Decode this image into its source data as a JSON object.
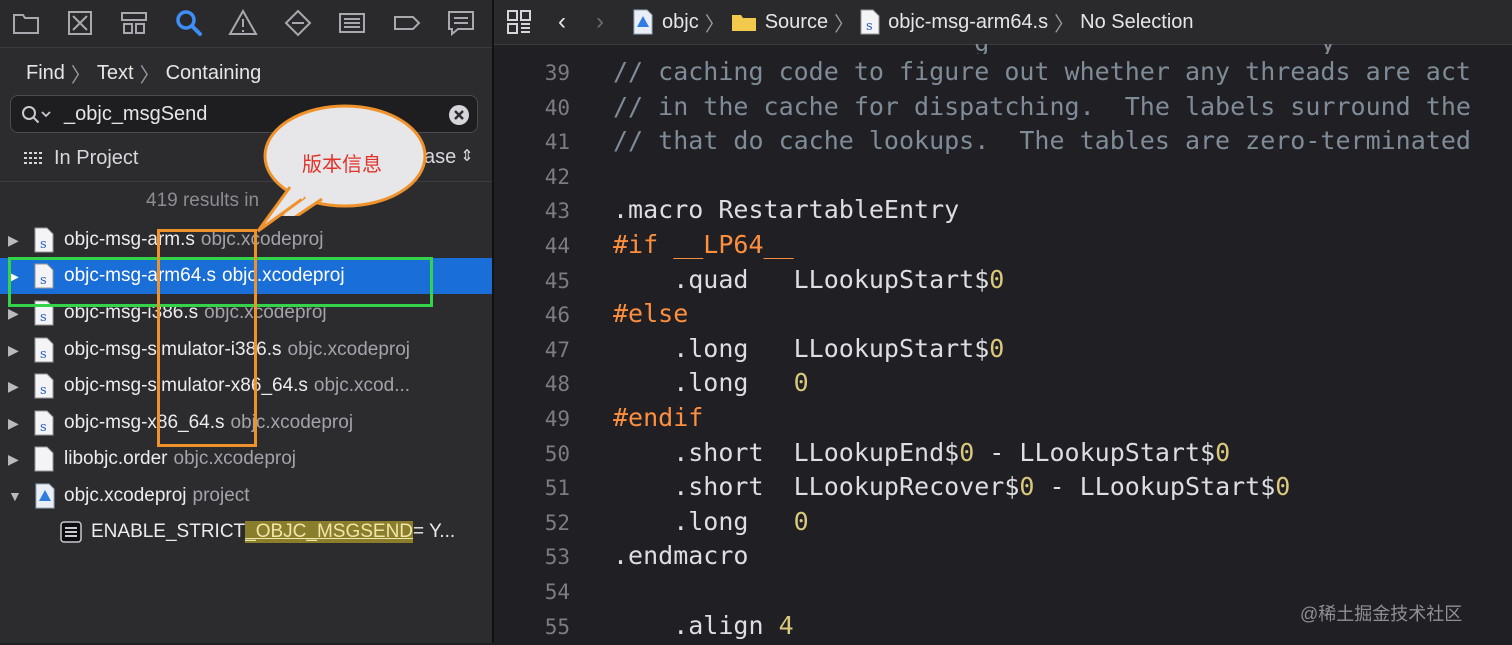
{
  "navigator": {
    "breadcrumb": [
      "Find",
      "Text",
      "Containing"
    ],
    "search": {
      "value": "_objc_msgSend"
    },
    "scope": {
      "label": "In Project",
      "option": "ase"
    },
    "results_count": "419 results in",
    "results": [
      {
        "file": "objc-msg-arm.s",
        "project": "objc.xcodeproj",
        "expanded": false,
        "selected": false
      },
      {
        "file": "objc-msg-arm64.s",
        "project": "objc.xcodeproj",
        "expanded": false,
        "selected": true
      },
      {
        "file": "objc-msg-i386.s",
        "project": "objc.xcodeproj",
        "expanded": false,
        "selected": false
      },
      {
        "file": "objc-msg-simulator-i386.s",
        "project": "objc.xcodeproj",
        "expanded": false,
        "selected": false
      },
      {
        "file": "objc-msg-simulator-x86_64.s",
        "project": "objc.xcod...",
        "expanded": false,
        "selected": false
      },
      {
        "file": "objc-msg-x86_64.s",
        "project": "objc.xcodeproj",
        "expanded": false,
        "selected": false
      },
      {
        "file": "libobjc.order",
        "project": "objc.xcodeproj",
        "expanded": false,
        "selected": false
      },
      {
        "file": "objc.xcodeproj",
        "project": "project",
        "expanded": true,
        "selected": false
      }
    ],
    "setting_match": {
      "prefix": "ENABLE_STRICT",
      "match": "_OBJC_MSGSEND",
      "suffix": " = Y..."
    }
  },
  "jumpbar": {
    "items": [
      "objc",
      "Source",
      "objc-msg-arm64.s",
      "No Selection"
    ]
  },
  "code": {
    "lines": [
      {
        "n": "39",
        "text": "// caching code to figure out whether any threads are act"
      },
      {
        "n": "40",
        "text": "// in the cache for dispatching.  The labels surround the"
      },
      {
        "n": "41",
        "text": "// that do cache lookups.  The tables are zero-terminated"
      },
      {
        "n": "42",
        "text": ""
      },
      {
        "n": "43",
        "text": ".macro RestartableEntry"
      },
      {
        "n": "44",
        "text": "#if __LP64__"
      },
      {
        "n": "45",
        "text": "    .quad   LLookupStart$",
        "num": "0"
      },
      {
        "n": "46",
        "text": "#else"
      },
      {
        "n": "47",
        "text": "    .long   LLookupStart$",
        "num": "0"
      },
      {
        "n": "48",
        "text": "    .long   ",
        "num": "0"
      },
      {
        "n": "49",
        "text": "#endif"
      },
      {
        "n": "50",
        "text": "    .short  LLookupEnd$",
        "num": "0",
        "rest": " - LLookupStart$",
        "num2": "0"
      },
      {
        "n": "51",
        "text": "    .short  LLookupRecover$",
        "num": "0",
        "rest": " - LLookupStart$",
        "num2": "0"
      },
      {
        "n": "52",
        "text": "    .long   ",
        "num": "0"
      },
      {
        "n": "53",
        "text": ".endmacro"
      },
      {
        "n": "54",
        "text": ""
      },
      {
        "n": "55",
        "text": "    .align ",
        "num": "4"
      }
    ]
  },
  "annotation": {
    "bubble_text": "版本信息"
  },
  "watermark": "@稀土掘金技术社区",
  "colors": {
    "selection": "#1a6ed8",
    "green_box": "#33d44a",
    "orange_box": "#f0922b",
    "preprocessor": "#fd8f3f",
    "number": "#d9c97c",
    "comment": "#7f8c98"
  }
}
